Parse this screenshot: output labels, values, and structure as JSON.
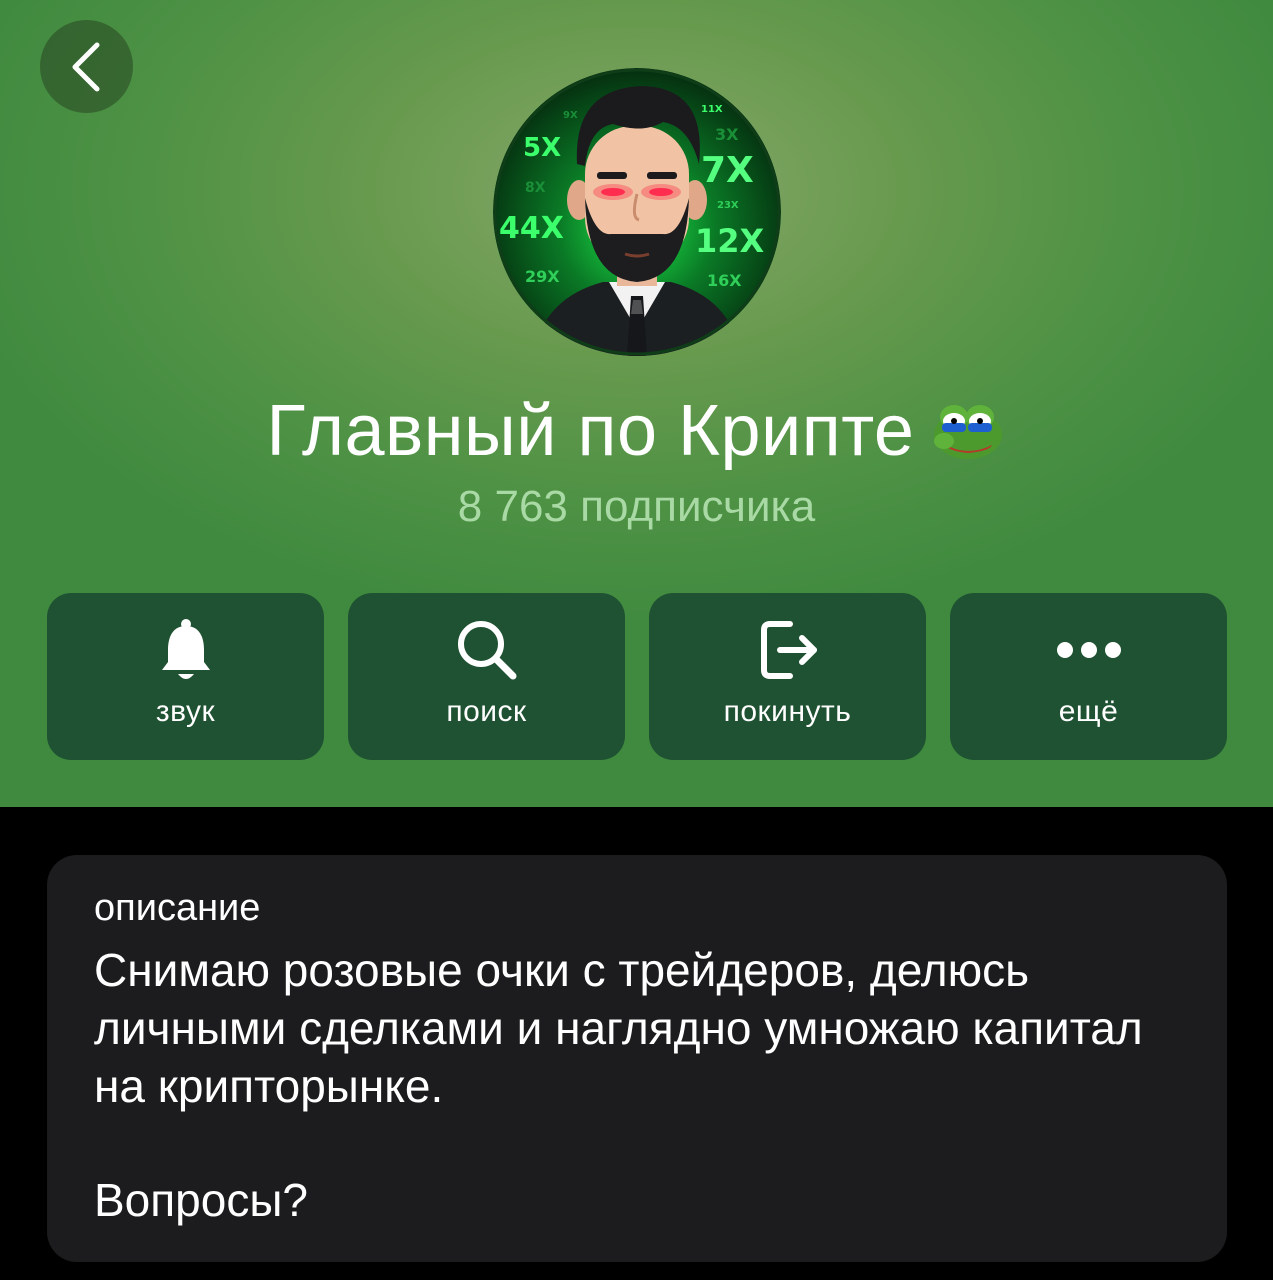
{
  "channel": {
    "title": "Главный по Крипте",
    "subscribers": "8 763 подписчика",
    "avatar_multipliers": [
      "5X",
      "8X",
      "44X",
      "29X",
      "7X",
      "3X",
      "11X",
      "23X",
      "12X",
      "16X",
      "9X"
    ]
  },
  "actions": [
    {
      "label": "звук",
      "icon": "bell-icon"
    },
    {
      "label": "поиск",
      "icon": "search-icon"
    },
    {
      "label": "покинуть",
      "icon": "leave-icon"
    },
    {
      "label": "ещё",
      "icon": "more-icon"
    }
  ],
  "description": {
    "label": "описание",
    "text": "Снимаю розовые очки с трейдеров, делюсь личными сделками и наглядно умножаю капитал на крипторынке.",
    "question": "Вопросы?"
  },
  "colors": {
    "header_green": "#5c9a4a",
    "action_bg": "#1f5232",
    "card_bg": "#1c1c1e",
    "subtitle": "#a9d9a4"
  }
}
